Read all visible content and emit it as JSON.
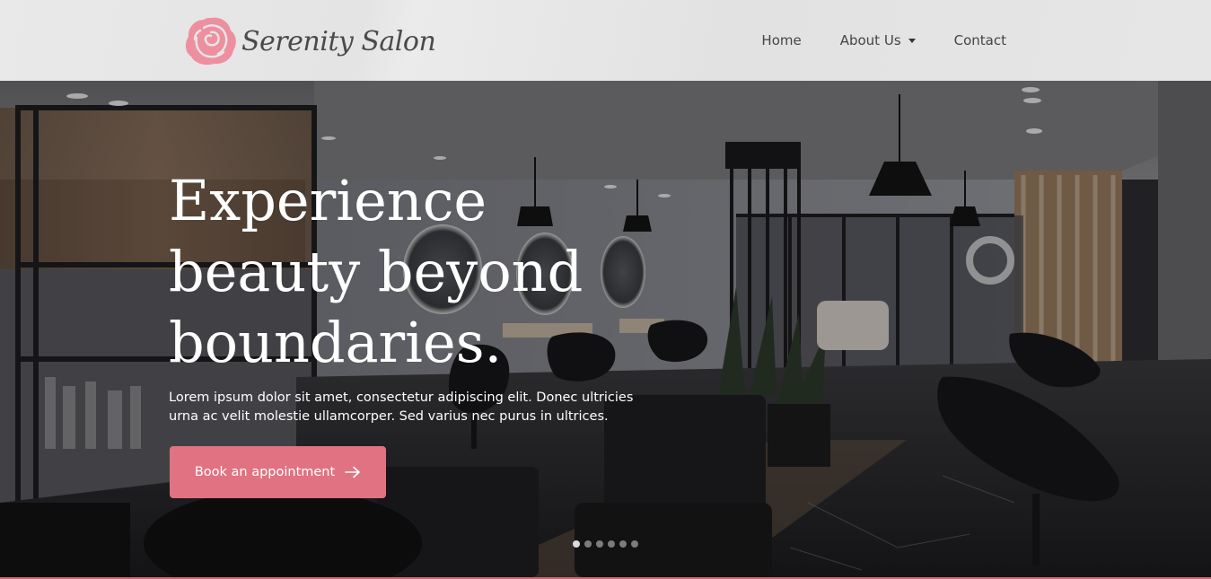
{
  "header": {
    "brand": "Serenity Salon",
    "nav": [
      {
        "label": "Home"
      },
      {
        "label": "About Us"
      },
      {
        "label": "Contact"
      }
    ]
  },
  "hero": {
    "title": "Experience beauty beyond boundaries.",
    "description": "Lorem ipsum dolor sit amet, consectetur adipiscing elit. Donec ultricies urna ac velit molestie ullamcorper. Sed varius nec purus in ultrices.",
    "cta_label": "Book an appointment",
    "slides": 6,
    "active_slide": 1
  },
  "colors": {
    "accent": "#e07282",
    "logo_pink": "#ee8a9c",
    "header_bg": "#e6e6e6"
  }
}
